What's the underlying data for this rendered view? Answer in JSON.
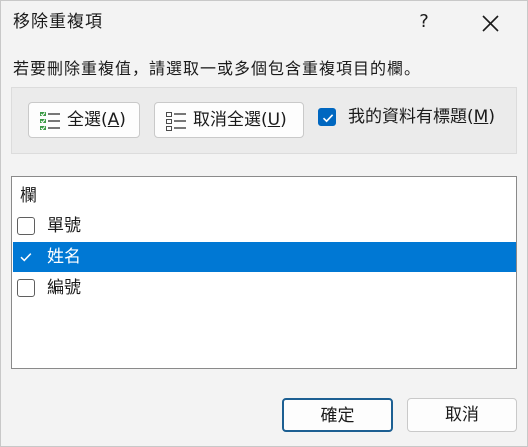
{
  "window": {
    "title": "移除重複項",
    "help_label": "?",
    "close_icon": "close-icon"
  },
  "instruction": "若要刪除重複值，請選取一或多個包含重複項目的欄。",
  "toolbar": {
    "select_all": {
      "text": "全選",
      "mnemonic": "A",
      "icon": "select-all-icon"
    },
    "unselect_all": {
      "text": "取消全選",
      "mnemonic": "U",
      "icon": "unselect-all-icon"
    },
    "has_headers": {
      "text": "我的資料有標題",
      "mnemonic": "M",
      "checked": true
    }
  },
  "columns": {
    "header": "欄",
    "items": [
      {
        "label": "單號",
        "checked": false,
        "selected": false
      },
      {
        "label": "姓名",
        "checked": true,
        "selected": true
      },
      {
        "label": "編號",
        "checked": false,
        "selected": false
      }
    ]
  },
  "footer": {
    "ok_label": "確定",
    "cancel_label": "取消"
  },
  "colors": {
    "accent": "#0067c0",
    "selection": "#0078d4",
    "dialog_bg": "#f3f3f3",
    "panel_bg": "#ebebeb"
  }
}
